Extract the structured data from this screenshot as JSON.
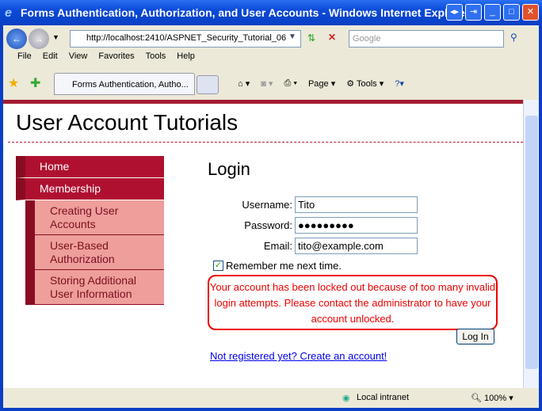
{
  "window": {
    "title": "Forms Authentication, Authorization, and User Accounts - Windows Internet Explorer"
  },
  "browser": {
    "url": "http://localhost:2410/ASPNET_Security_Tutorial_06",
    "search_placeholder": "Google",
    "menu": [
      "File",
      "Edit",
      "View",
      "Favorites",
      "Tools",
      "Help"
    ],
    "tab_title": "Forms Authentication, Autho...",
    "tools": [
      "Page",
      "Tools"
    ],
    "status_zone": "Local intranet",
    "zoom": "100%"
  },
  "site": {
    "title": "User Account Tutorials",
    "nav": [
      "Home",
      "Membership"
    ],
    "subnav": [
      "Creating User Accounts",
      "User-Based Authorization",
      "Storing Additional User Information"
    ]
  },
  "login": {
    "heading": "Login",
    "username_label": "Username:",
    "username": "Tito",
    "password_label": "Password:",
    "password": "●●●●●●●●●",
    "email_label": "Email:",
    "email": "tito@example.com",
    "remember": "Remember me next time.",
    "error": "Your account has been locked out because of too many invalid login attempts. Please contact the administrator to have your account unlocked.",
    "button": "Log In",
    "register_link": "Not registered yet? Create an account!"
  }
}
